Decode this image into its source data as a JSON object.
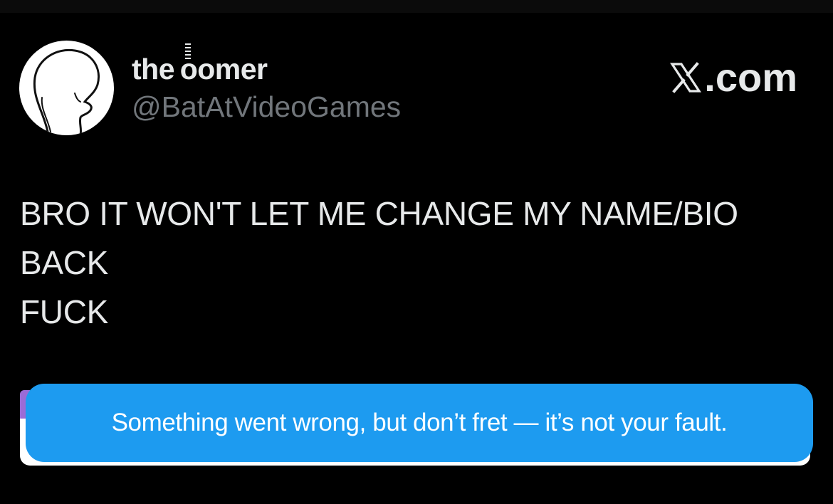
{
  "post": {
    "display_name": "the oomer",
    "handle": "@BatAtVideoGames",
    "text_lines": [
      "BRO IT WON'T LET ME CHANGE MY NAME/BIO",
      "BACK",
      "FUCK"
    ]
  },
  "brand": {
    "domain_text": ".com",
    "logo_icon": "x-logo-icon"
  },
  "toast": {
    "message": "Something went wrong, but don’t fret — it’s not your fault."
  },
  "colors": {
    "background": "#000000",
    "primary_text": "#e7e9ea",
    "secondary_text": "#71767b",
    "toast_background": "#1d9bf0",
    "toast_text": "#ffffff"
  }
}
